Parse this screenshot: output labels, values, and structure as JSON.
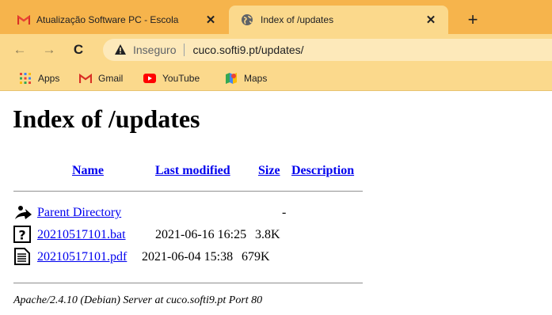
{
  "tabs": [
    {
      "title": "Atualização Software PC - Escola",
      "favicon": "gmail-icon",
      "active": false
    },
    {
      "title": "Index of /updates",
      "favicon": "globe-icon",
      "active": true
    }
  ],
  "new_tab_label": "+",
  "omnibox": {
    "security_label": "Inseguro",
    "url": "cuco.softi9.pt/updates/"
  },
  "bookmarks": [
    {
      "label": "Apps",
      "icon": "apps-grid-icon"
    },
    {
      "label": "Gmail",
      "icon": "gmail-icon"
    },
    {
      "label": "YouTube",
      "icon": "youtube-icon"
    },
    {
      "label": "Maps",
      "icon": "maps-icon"
    }
  ],
  "page": {
    "title": "Index of /updates",
    "columns": {
      "name": "Name",
      "last_modified": "Last modified",
      "size": "Size",
      "description": "Description"
    },
    "rows": [
      {
        "name": "Parent Directory",
        "modified": "",
        "size": "-",
        "icon": "back-folder-icon"
      },
      {
        "name": "20210517101.bat",
        "modified": "2021-06-16 16:25",
        "size": "3.8K",
        "icon": "unknown-file-icon"
      },
      {
        "name": "20210517101.pdf",
        "modified": "2021-06-04 15:38",
        "size": "679K",
        "icon": "text-file-icon"
      }
    ],
    "footer": "Apache/2.4.10 (Debian) Server at cuco.softi9.pt Port 80"
  },
  "colors": {
    "tabstrip": "#f6b44c",
    "toolbar": "#fbd98c",
    "omnibox": "#fde9ba",
    "link": "#0000ee"
  }
}
